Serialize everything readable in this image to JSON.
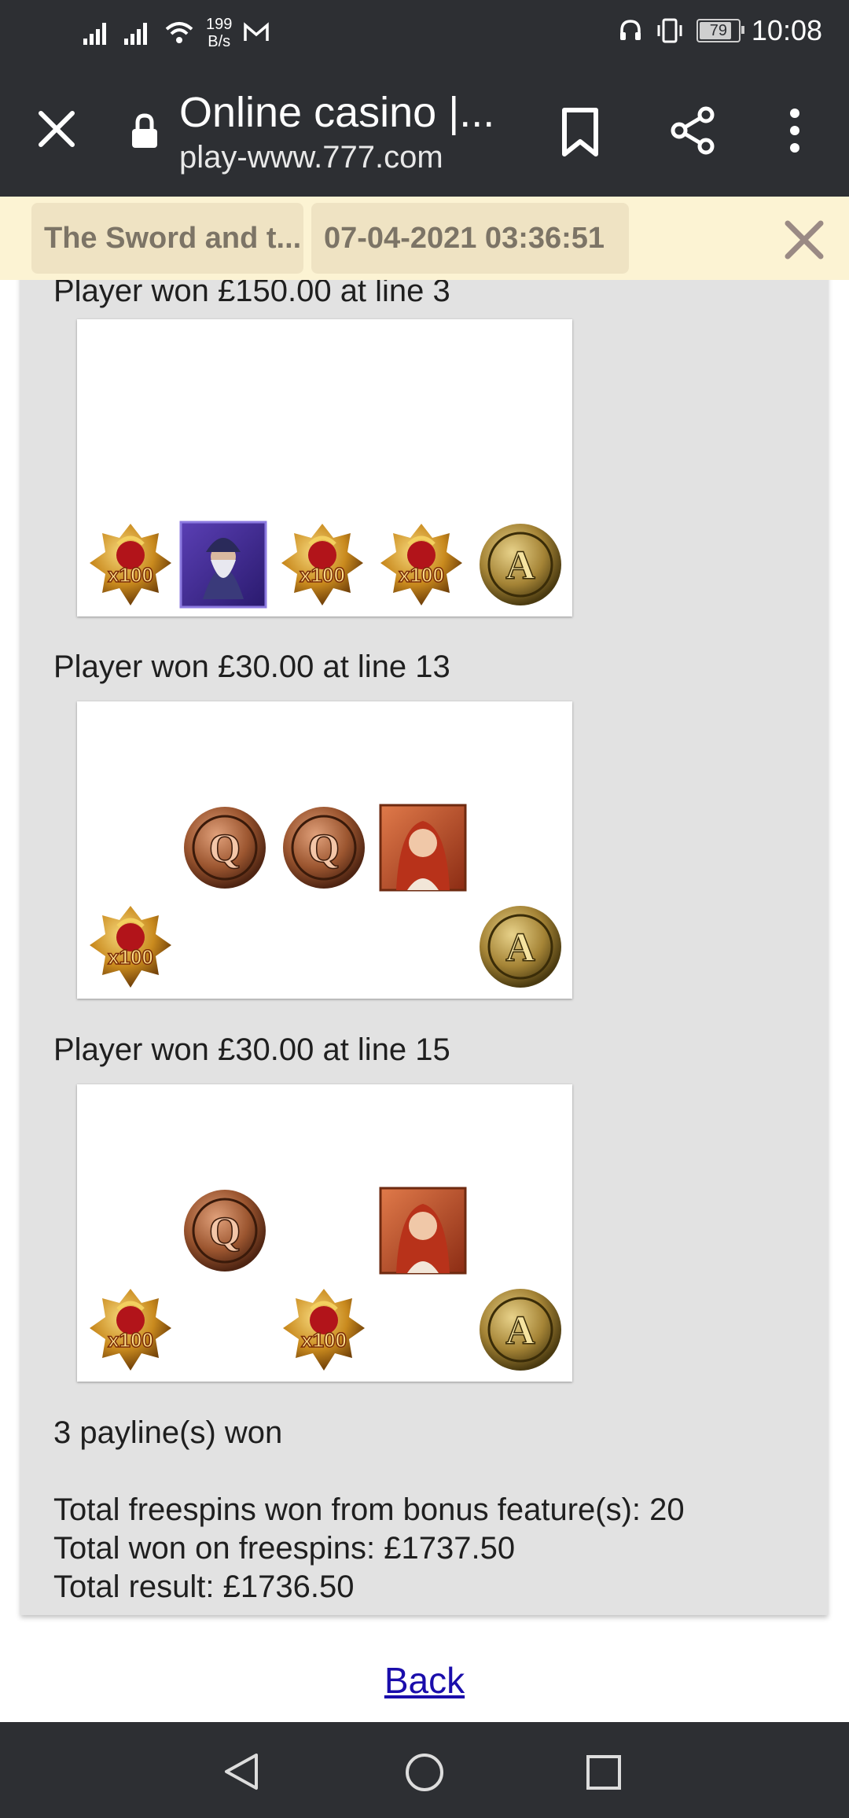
{
  "status_bar": {
    "speed_value": "199",
    "speed_unit": "B/s",
    "battery": "79",
    "time": "10:08"
  },
  "toolbar": {
    "title": "Online casino |...",
    "url": "play-www.777.com",
    "icons": [
      "close-icon",
      "lock-icon",
      "bookmark-icon",
      "share-icon",
      "more-vert-icon"
    ]
  },
  "info_bar": {
    "game_chip": "The Sword and t...",
    "date_chip": "07-04-2021 03:36:51"
  },
  "history": {
    "partial_line": "Player won £150.00 at line 3",
    "win_line_13": "Player won £30.00 at line 13",
    "win_line_15": "Player won £30.00 at line 15",
    "paylines_won": "3 payline(s) won",
    "total_freespins": "Total freespins won from bonus feature(s): 20",
    "total_won_freespins": "Total won on freespins: £1737.50",
    "total_result": "Total result: £1736.50",
    "reel_symbols": {
      "grid1": [
        "shield-x100",
        "wizard",
        "shield-x100",
        "shield-x100",
        "coin-a"
      ],
      "grid2": [
        "shield-x100",
        "coin-q",
        "coin-q",
        "queen-portrait",
        "coin-a"
      ],
      "grid3": [
        "shield-x100",
        "coin-q",
        "shield-x100",
        "queen-portrait",
        "coin-a"
      ]
    }
  },
  "back_link": "Back",
  "colors": {
    "statusbar": "#2d2f33",
    "infobar": "#fcf3d3",
    "panel": "#e2e2e2",
    "link": "#1a0dab"
  }
}
